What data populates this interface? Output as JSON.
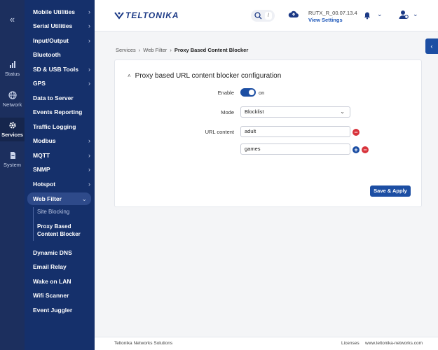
{
  "rail": {
    "items": [
      {
        "label": "Status",
        "icon": "bar-chart-icon"
      },
      {
        "label": "Network",
        "icon": "globe-icon"
      },
      {
        "label": "Services",
        "icon": "gear-icon"
      },
      {
        "label": "System",
        "icon": "file-icon"
      }
    ]
  },
  "menu": {
    "items": [
      {
        "label": "Mobile Utilities",
        "chevron": "›"
      },
      {
        "label": "Serial Utilities",
        "chevron": "›"
      },
      {
        "label": "Input/Output",
        "chevron": "›"
      },
      {
        "label": "Bluetooth",
        "chevron": ""
      },
      {
        "label": "SD & USB Tools",
        "chevron": "›"
      },
      {
        "label": "GPS",
        "chevron": "›"
      },
      {
        "label": "Data to Server",
        "chevron": ""
      },
      {
        "label": "Events Reporting",
        "chevron": ""
      },
      {
        "label": "Traffic Logging",
        "chevron": ""
      },
      {
        "label": "Modbus",
        "chevron": "›"
      },
      {
        "label": "MQTT",
        "chevron": "›"
      },
      {
        "label": "SNMP",
        "chevron": "›"
      },
      {
        "label": "Hotspot",
        "chevron": "›"
      },
      {
        "label": "Web Filter",
        "chevron": "⌄"
      },
      {
        "label": "Dynamic DNS",
        "chevron": ""
      },
      {
        "label": "Email Relay",
        "chevron": ""
      },
      {
        "label": "Wake on LAN",
        "chevron": ""
      },
      {
        "label": "Wifi Scanner",
        "chevron": ""
      },
      {
        "label": "Event Juggler",
        "chevron": ""
      }
    ],
    "web_filter_sub": [
      "Site Blocking",
      "Proxy Based",
      "Content Blocker"
    ]
  },
  "header": {
    "logo": "TELTONIKA",
    "search_shortcut": "/",
    "firmware_version": "RUTX_R_00.07.13.4",
    "firmware_link": "View Settings"
  },
  "breadcrumb": [
    "Services",
    "Web Filter",
    "Proxy Based Content Blocker"
  ],
  "form": {
    "title": "Proxy based URL content blocker configuration",
    "enable_label": "Enable",
    "enable_state": "on",
    "mode_label": "Mode",
    "mode_value": "Blocklist",
    "url_label": "URL content",
    "urls": [
      "adult",
      "games"
    ],
    "save_label": "Save & Apply"
  },
  "footer": {
    "company": "Teltonika Networks Solutions",
    "licenses": "Licenses",
    "site": "www.teltonika-networks.com"
  },
  "colors": {
    "rail_bg": "#1c2f5e",
    "menu_bg": "#15306b",
    "accent": "#1c4ea3",
    "remove": "#d8343c"
  }
}
